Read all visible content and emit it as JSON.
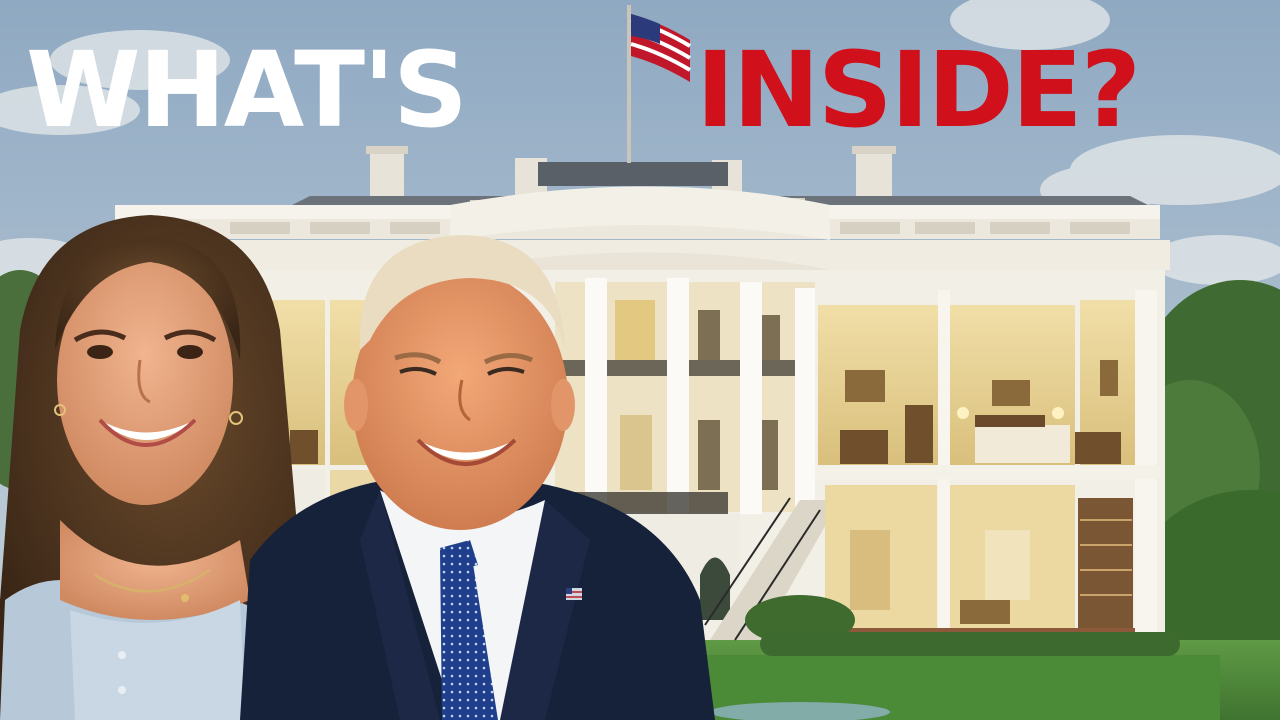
{
  "title": {
    "word_1": "WHAT'S",
    "word_2": "INSIDE?",
    "color_1": "#ffffff",
    "color_2": "#d0101a"
  },
  "colors": {
    "sky": "#a9bccd",
    "building": "#f2efe6",
    "lawn": "#4f8a3a",
    "suit": "#16213a",
    "tie": "#1d3f8a",
    "interior": "#e9d49a"
  },
  "scene": {
    "background": "white-house-cutaway-illustration",
    "people": [
      "young-woman-smiling",
      "man-in-suit-smiling"
    ],
    "flag": "us-flag-icon",
    "lapel_pin": "us-flag-pin-icon"
  }
}
